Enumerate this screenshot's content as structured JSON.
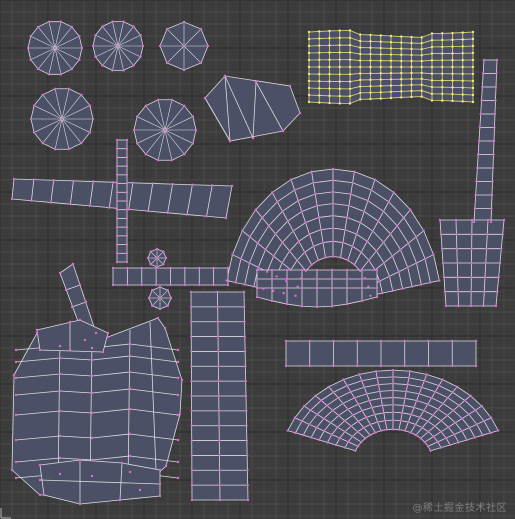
{
  "editor": {
    "watermark": "@稀土掘金技术社区",
    "colors": {
      "background": "#3c3c3c",
      "grid_minor": "#4a4a4a",
      "grid_major": "#2c2c2c",
      "island_fill": "#4b5066",
      "edge": "#dcdcdc",
      "vertex": "#e06ad8",
      "selected_edge": "#e7dc6e",
      "selected_vertex": "#f2ea84"
    },
    "icons": {
      "origin": "axis-gizmo-icon"
    }
  }
}
